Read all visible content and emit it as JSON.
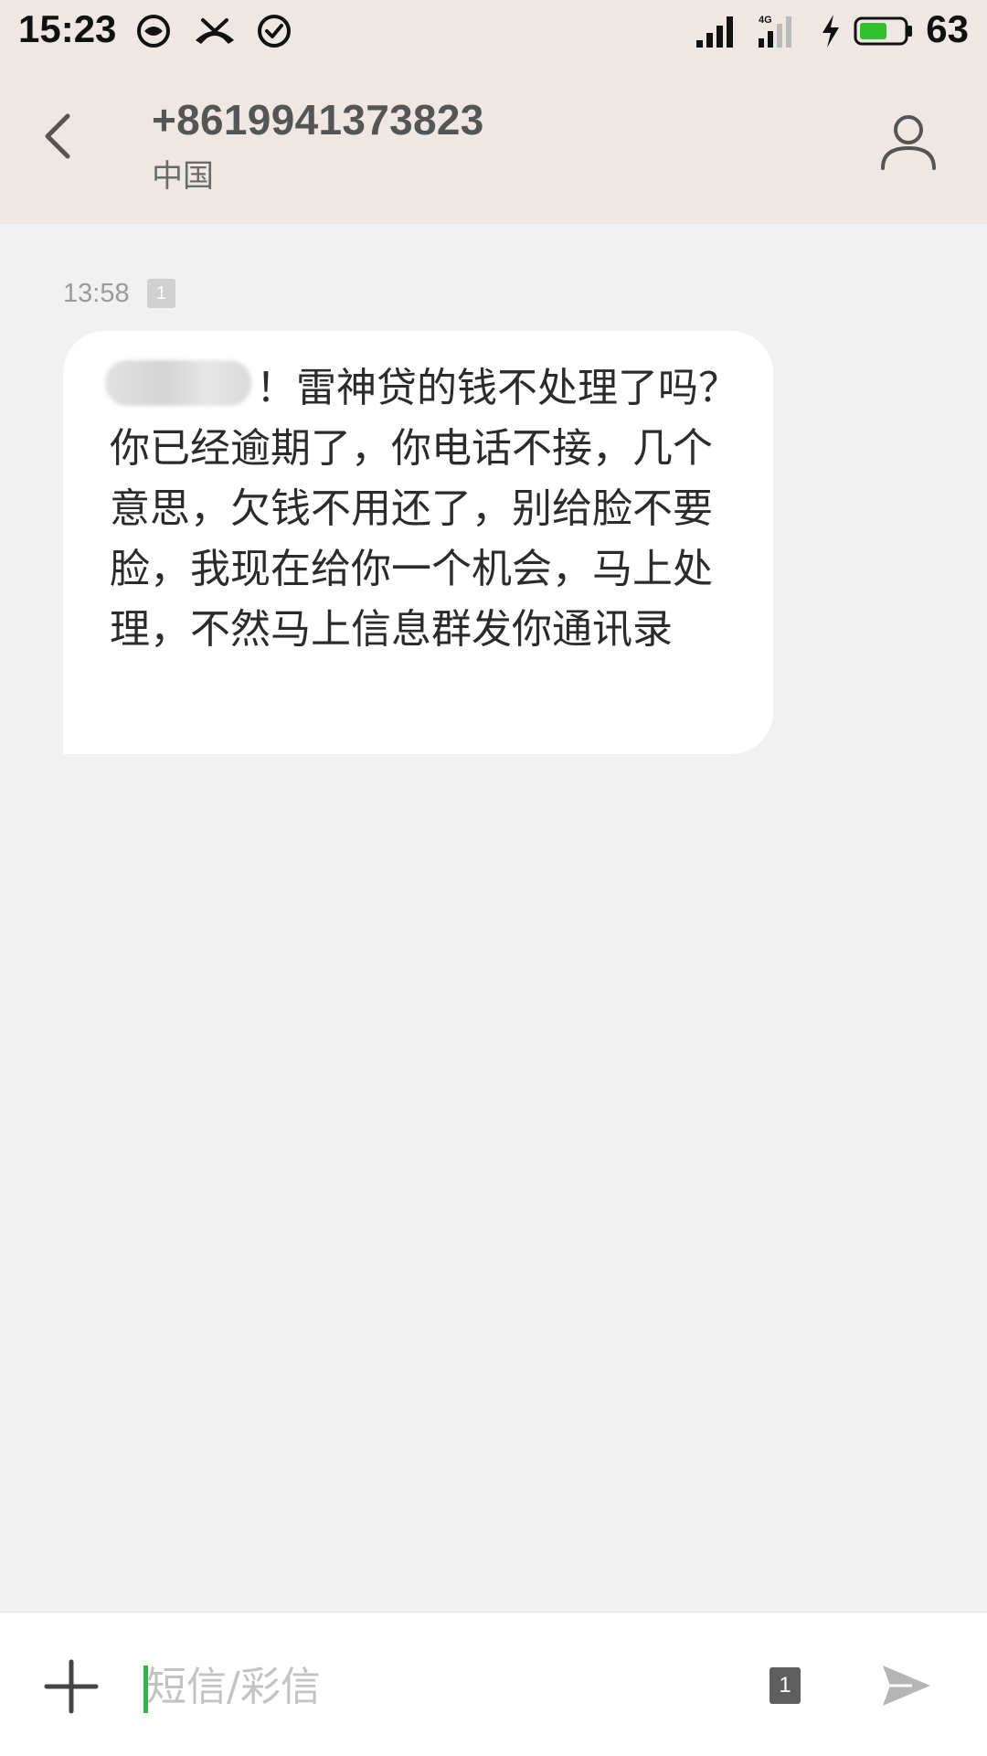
{
  "status_bar": {
    "time": "15:23",
    "network_type": "4G",
    "battery_percent": "63",
    "battery_level": 0.63,
    "icons": [
      "face-notification-icon",
      "missed-call-icon",
      "check-circle-icon",
      "signal-icon",
      "signal-4g-icon",
      "charging-icon",
      "battery-icon"
    ]
  },
  "header": {
    "contact_number": "+8619941373823",
    "contact_region": "中国",
    "back_icon": "chevron-left-icon",
    "contact_icon": "person-icon"
  },
  "messages": [
    {
      "timestamp": "13:58",
      "sim": "1",
      "text": "！雷神贷的钱不处理了吗？你已经逾期了，你电话不接，几个意思，欠钱不用还了，别给脸不要脸，我现在给你一个机会，马上处理，不然马上信息群发你通讯录"
    }
  ],
  "composer": {
    "placeholder": "短信/彩信",
    "value": "",
    "sim": "1",
    "add_icon": "plus-icon",
    "send_icon": "send-icon"
  },
  "colors": {
    "header_bg": "#efe7e4",
    "chat_bg": "#f1f1f1",
    "bubble_bg": "#ffffff",
    "cursor_accent": "#35b34a",
    "battery_fill": "#2fc12f"
  }
}
